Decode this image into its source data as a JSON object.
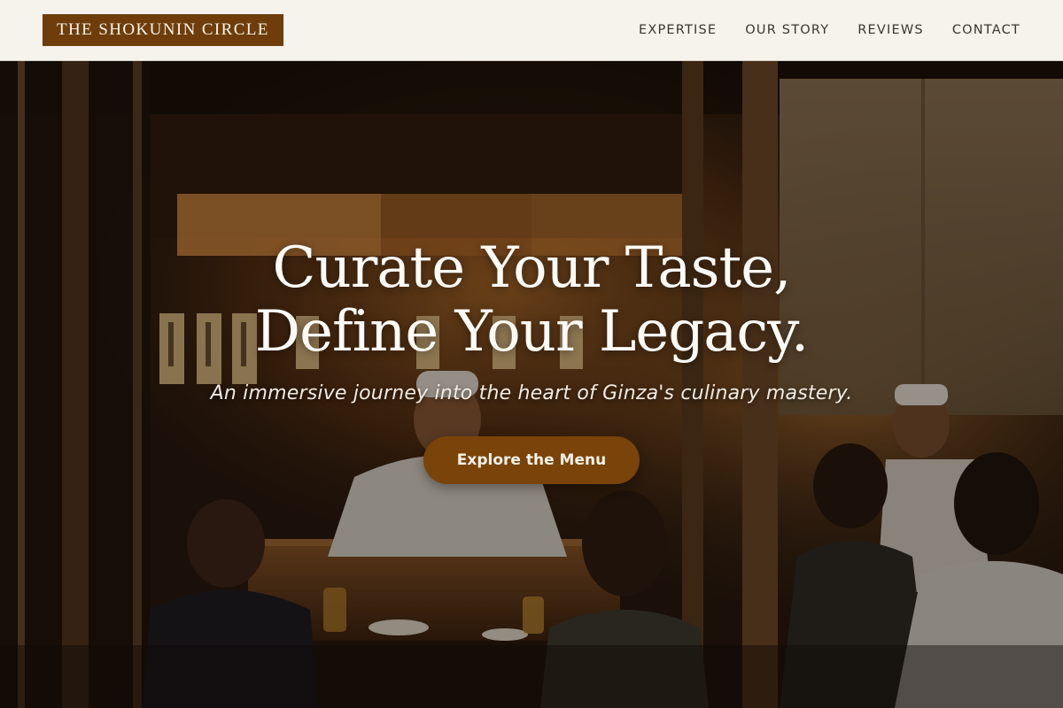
{
  "brand": {
    "name": "THE SHOKUNIN CIRCLE",
    "accent_color": "#6e3d0b"
  },
  "nav": {
    "items": [
      {
        "label": "EXPERTISE"
      },
      {
        "label": "OUR STORY"
      },
      {
        "label": "REVIEWS"
      },
      {
        "label": "CONTACT"
      }
    ]
  },
  "hero": {
    "headline_line1": "Curate Your Taste,",
    "headline_line2": "Define Your Legacy.",
    "subheadline": "An immersive journey into the heart of Ginza's culinary mastery.",
    "cta_label": "Explore the Menu",
    "cta_color": "#7a4309",
    "background_image": "photo of a busy Japanese izakaya interior with chefs and diners"
  },
  "colors": {
    "header_bg": "#f6f2ec",
    "nav_text": "#3b3530",
    "headline_text": "#fdfbf7"
  }
}
